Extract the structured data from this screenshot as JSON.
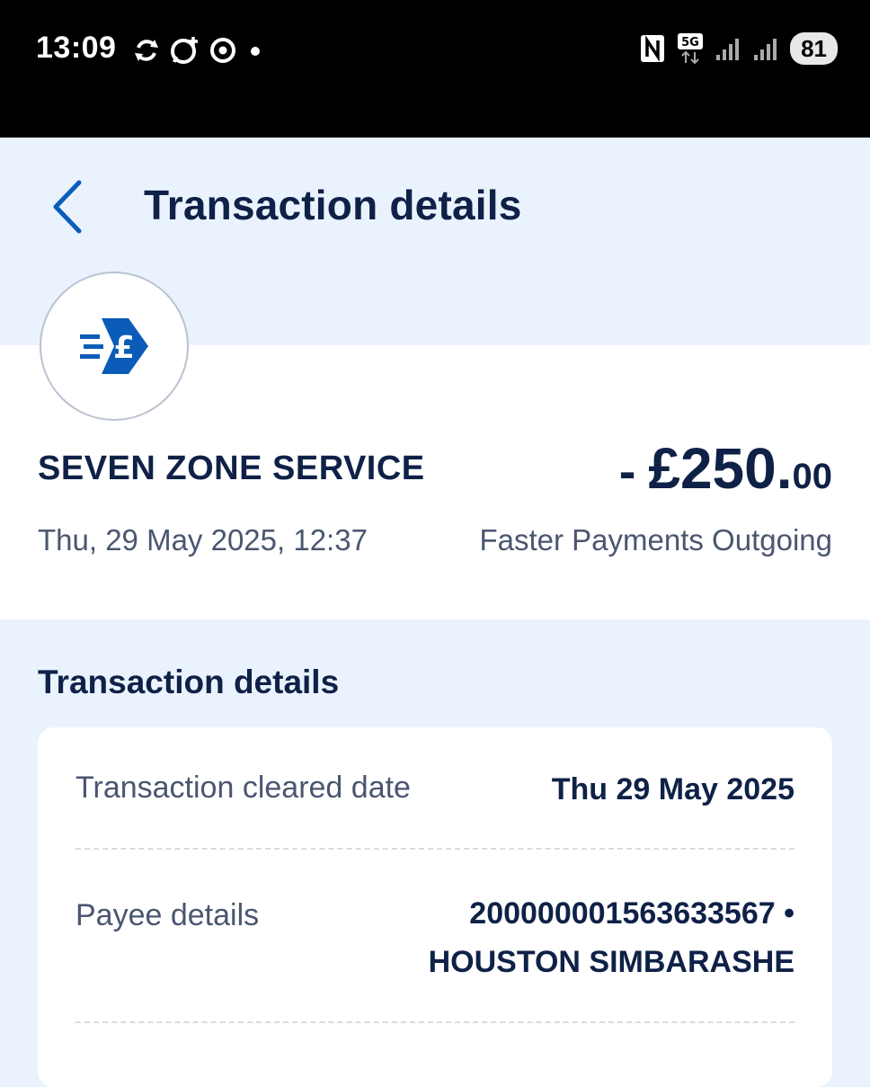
{
  "status_bar": {
    "time": "13:09",
    "battery": "81",
    "network": "5G"
  },
  "header": {
    "title": "Transaction details",
    "back_icon": "chevron-left-icon"
  },
  "summary": {
    "logo_icon": "faster-payment-pound-icon",
    "merchant": "SEVEN ZONE SERVICE",
    "amount_sign": "-",
    "amount_main": "£250.",
    "amount_pence": "00",
    "date": "Thu, 29 May 2025, 12:37",
    "type": "Faster Payments Outgoing"
  },
  "details": {
    "section_title": "Transaction details",
    "rows": [
      {
        "label": "Transaction cleared date",
        "value": "Thu 29 May 2025"
      },
      {
        "label": "Payee details",
        "value_line1": "200000001563633567 •",
        "value_line2": "HOUSTON SIMBARASHE"
      }
    ]
  },
  "colors": {
    "brand_blue": "#0a5cb8",
    "navy_text": "#0f2147",
    "background": "#eaf3fd"
  }
}
